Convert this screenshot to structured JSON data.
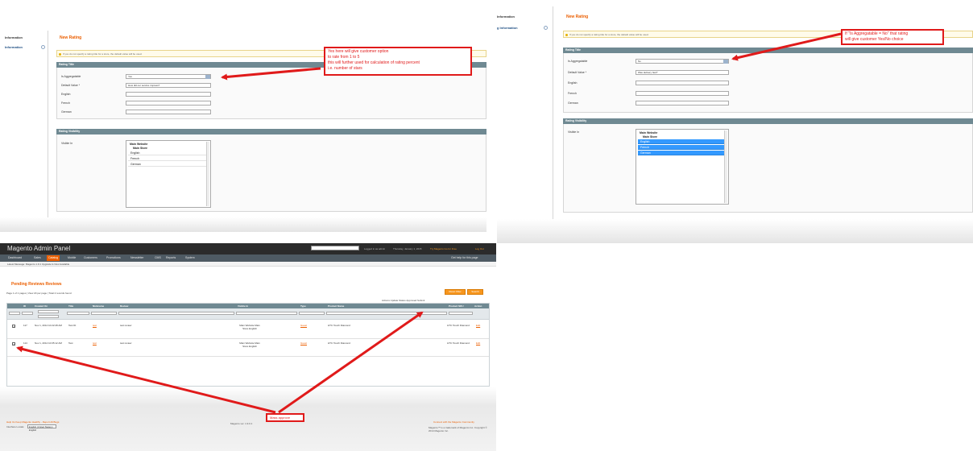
{
  "form_left": {
    "sidebar": {
      "items": [
        {
          "label": "Information"
        },
        {
          "label": "Information"
        }
      ]
    },
    "title": "New Rating",
    "notice": "If you do not specify a rating title for a store, the default value will be used.",
    "section_title": "Rating Title",
    "fields": [
      {
        "label": "Is Aggregatable",
        "value": "Yes"
      },
      {
        "label": "Default Value *",
        "value": "How did our service impress?"
      },
      {
        "label": "English",
        "value": ""
      },
      {
        "label": "French",
        "value": ""
      },
      {
        "label": "German",
        "value": ""
      }
    ],
    "visibility_title": "Rating Visibility",
    "visible_in_label": "Visible In",
    "visible_options": [
      {
        "label": "Main Website",
        "kind": "group"
      },
      {
        "label": "Main Store",
        "kind": "store"
      },
      {
        "label": "English",
        "kind": "view"
      },
      {
        "label": "French",
        "kind": "view"
      },
      {
        "label": "German",
        "kind": "view"
      }
    ],
    "callout": [
      "Yes here will give customer option",
      "to rate from 1 to 5",
      "this will further used for calculation of rating percent",
      "i.e. number of stars"
    ]
  },
  "form_right": {
    "sidebar": {
      "items": [
        {
          "label": "Information"
        },
        {
          "label": "g Information"
        }
      ]
    },
    "title": "New Rating",
    "notice": "If you do not specify a rating title for a store, the default value will be used.",
    "section_title": "Rating Title",
    "fields": [
      {
        "label": "Is Aggregatable",
        "value": "No"
      },
      {
        "label": "Default Value *",
        "value": "Was delivery fast?"
      },
      {
        "label": "English",
        "value": ""
      },
      {
        "label": "French",
        "value": ""
      },
      {
        "label": "German",
        "value": ""
      }
    ],
    "visibility_title": "Rating Visibility",
    "visible_in_label": "Visible In",
    "visible_options": [
      {
        "label": "Main Website",
        "kind": "group"
      },
      {
        "label": "Main Store",
        "kind": "store"
      },
      {
        "label": "English",
        "kind": "view-selected"
      },
      {
        "label": "French",
        "kind": "view-selected"
      },
      {
        "label": "German",
        "kind": "view-selected"
      }
    ],
    "callout": [
      "If \"Is Aggregatable = No\" that rating",
      "will give customer Yes/No choice"
    ]
  },
  "grid_panel": {
    "logo": "Magento Admin Panel",
    "top_links": [
      "Logged in as admin",
      "Thursday, January 1, 2015",
      "Try Magento Go for Free",
      "Log Out"
    ],
    "nav": [
      "Dashboard",
      "Sales",
      "Catalog",
      "Mobile",
      "Customers",
      "Promotions",
      "Newsletter",
      "CMS",
      "Reports",
      "System"
    ],
    "nav_help": "Get help for this page",
    "message": "Latest Message: Magento 1.9.1 Upgrade Is Now Available",
    "page_title": "Pending Reviews Reviews",
    "buttons": [
      "Reset Filter",
      "Search"
    ],
    "pager": "Page  1  of 1 pages | View 20 per page | Total 2 records found",
    "mass_action": "Actions Update Status Approved Submit",
    "columns": [
      "ID",
      "Created On",
      "Title",
      "Nickname",
      "Review",
      "Visible In",
      "Type",
      "Product Name",
      "Product SKU",
      "Action"
    ],
    "rows": [
      {
        "id": "117",
        "created": "Nov 1, 2014 10:22:28 AM",
        "title": "Test ID",
        "nickname": "test",
        "review": "test review",
        "visible": "Main Website Main Store English",
        "type": "Guest",
        "product": "HTC Touch Diamond",
        "sku": "HTC Touch Diamond",
        "action": "Edit"
      },
      {
        "id": "114",
        "created": "Nov 1, 2014 10:05:12 AM",
        "title": "Test",
        "nickname": "test",
        "review": "test review",
        "visible": "Main Website Main Store English",
        "type": "Guest",
        "product": "HTC Touch Diamond",
        "sku": "HTC Touch Diamond",
        "action": "Edit"
      }
    ],
    "footer_left": "Help Us Keep Magento Healthy - Report All Bugs",
    "footer_locale_label": "Interface Locale:",
    "footer_locale_value": "English (United States) / English",
    "footer_center": "Magento ver. 1.9.0.1",
    "footer_right": "Connect with the Magento Community",
    "footer_copyright": "Magento™ is a trademark of Magento Inc. Copyright © 2014 Magento Inc.",
    "callout": "Mass approve"
  }
}
